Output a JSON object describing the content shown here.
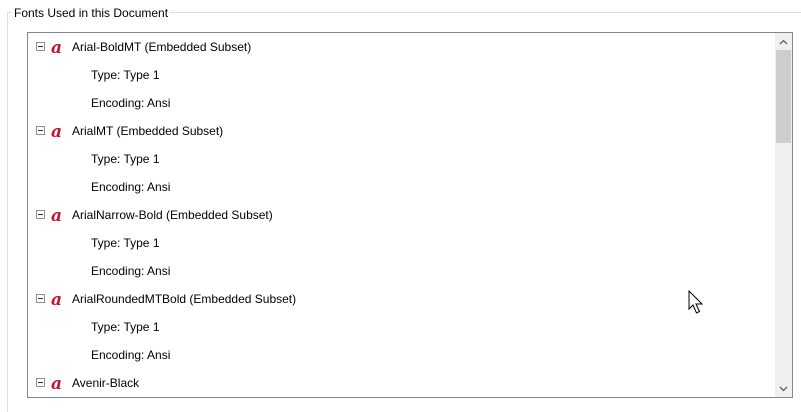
{
  "group": {
    "title": "Fonts Used in this Document"
  },
  "fonts": [
    {
      "name": "Arial-BoldMT (Embedded Subset)",
      "type": "Type: Type 1",
      "encoding": "Encoding: Ansi"
    },
    {
      "name": "ArialMT (Embedded Subset)",
      "type": "Type: Type 1",
      "encoding": "Encoding: Ansi"
    },
    {
      "name": "ArialNarrow-Bold (Embedded Subset)",
      "type": "Type: Type 1",
      "encoding": "Encoding: Ansi"
    },
    {
      "name": "ArialRoundedMTBold (Embedded Subset)",
      "type": "Type: Type 1",
      "encoding": "Encoding: Ansi"
    },
    {
      "name": "Avenir-Black"
    }
  ],
  "colors": {
    "font_icon": "#c8102e",
    "tree_border": "#828790",
    "scroll_thumb": "#cdcdcd"
  },
  "icons": {
    "toggle": "collapse-minus-icon",
    "font": "font-acrobat-icon",
    "scroll_up": "chevron-up-icon",
    "scroll_down": "chevron-down-icon",
    "cursor": "mouse-pointer-icon"
  }
}
